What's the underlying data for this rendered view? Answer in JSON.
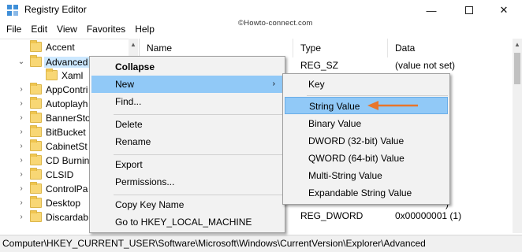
{
  "window": {
    "title": "Registry Editor",
    "minimize": "—",
    "close": "✕"
  },
  "watermark": "©Howto-connect.com",
  "menubar": [
    "File",
    "Edit",
    "View",
    "Favorites",
    "Help"
  ],
  "tree": {
    "items": [
      {
        "label": "Accent",
        "expander": ""
      },
      {
        "label": "Advanced",
        "expander": "⌄"
      },
      {
        "label": "Xaml",
        "expander": ""
      },
      {
        "label": "AppContri",
        "expander": "›"
      },
      {
        "label": "Autoplayh",
        "expander": "›"
      },
      {
        "label": "BannerSto",
        "expander": "›"
      },
      {
        "label": "BitBucket",
        "expander": "›"
      },
      {
        "label": "CabinetSt",
        "expander": "›"
      },
      {
        "label": "CD Burnin",
        "expander": "›"
      },
      {
        "label": "CLSID",
        "expander": "›"
      },
      {
        "label": "ControlPa",
        "expander": "›"
      },
      {
        "label": "Desktop",
        "expander": "›"
      },
      {
        "label": "Discardab",
        "expander": "›"
      }
    ]
  },
  "list": {
    "headers": {
      "name": "Name",
      "type": "Type",
      "data": "Data"
    },
    "rows": [
      {
        "type": "REG_SZ",
        "data": "(value not set)"
      },
      {
        "type": "",
        "data": ")"
      },
      {
        "type": "",
        "data": ")"
      },
      {
        "type": "",
        "data": ")"
      },
      {
        "type": "",
        "data": ")"
      },
      {
        "type": "",
        "data": ")"
      },
      {
        "type": "",
        "data": ")"
      },
      {
        "type": "",
        "data": ")"
      },
      {
        "type": "",
        "data": ")"
      },
      {
        "type": "REG_DWORD",
        "data": "0x00000001 (1)"
      }
    ]
  },
  "context_menu": {
    "items": [
      "Collapse",
      "New",
      "Find...",
      "Delete",
      "Rename",
      "Export",
      "Permissions...",
      "Copy Key Name",
      "Go to HKEY_LOCAL_MACHINE"
    ],
    "submenu_arrow": "›"
  },
  "submenu": {
    "items": [
      "Key",
      "String Value",
      "Binary Value",
      "DWORD (32-bit) Value",
      "QWORD (64-bit) Value",
      "Multi-String Value",
      "Expandable String Value"
    ]
  },
  "statusbar": "Computer\\HKEY_CURRENT_USER\\Software\\Microsoft\\Windows\\CurrentVersion\\Explorer\\Advanced",
  "colors": {
    "selection": "#cce8ff",
    "menu_highlight": "#91c9f7",
    "annotation_arrow": "#e8762c",
    "folder": "#f8d775"
  }
}
